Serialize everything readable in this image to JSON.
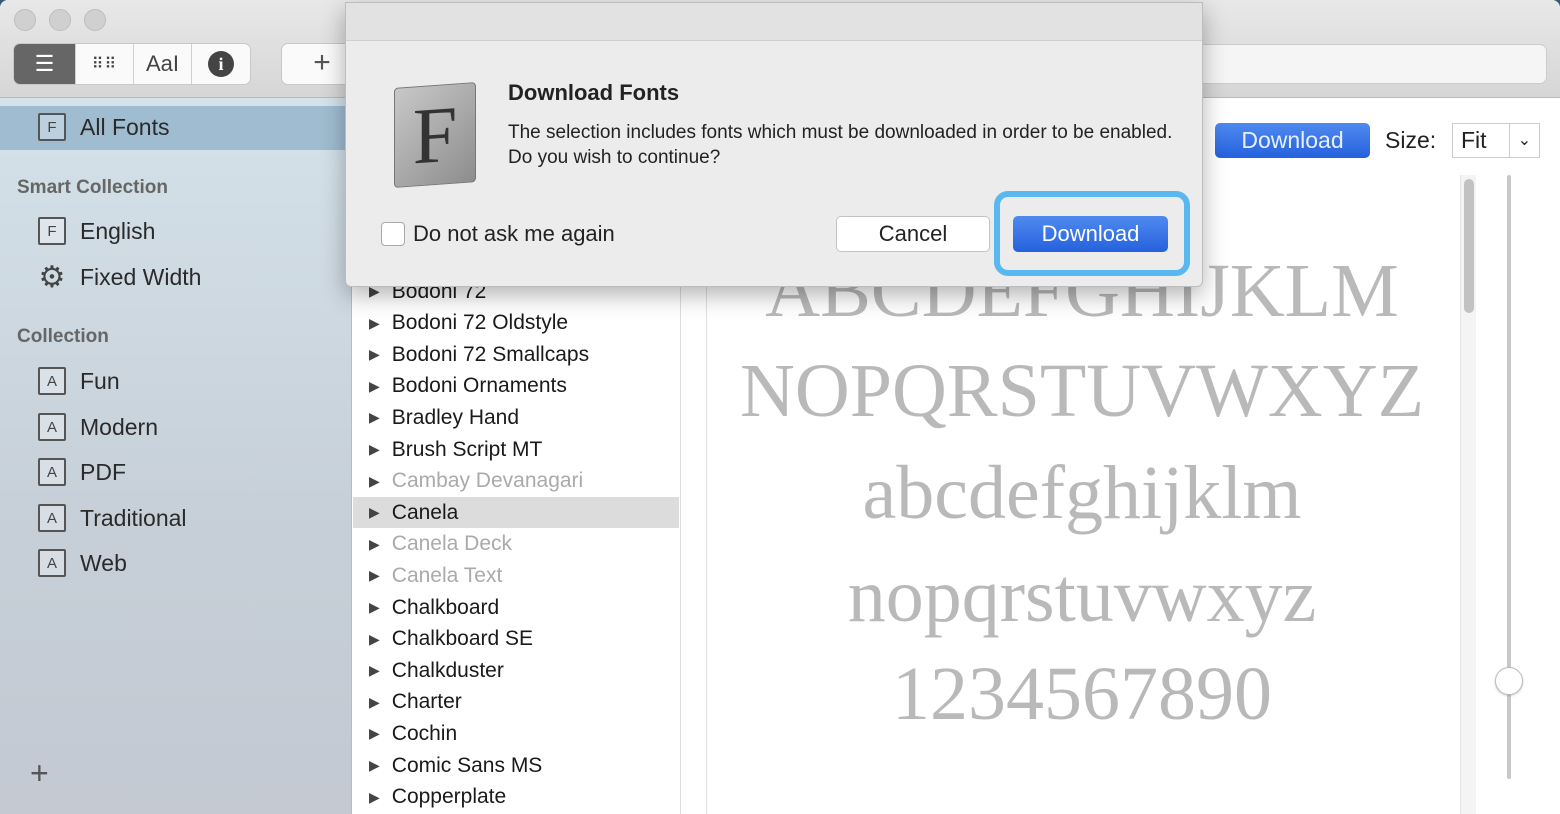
{
  "toolbar": {
    "views": [
      "list-view",
      "grid-view",
      "sample-view",
      "info-view"
    ],
    "sample_label": "AaI",
    "add_label": "+"
  },
  "sidebar": {
    "all_fonts": "All Fonts",
    "smart_header": "Smart Collection",
    "smart": [
      {
        "label": "English",
        "icon": "font-book-icon"
      },
      {
        "label": "Fixed Width",
        "icon": "gear-icon"
      }
    ],
    "collection_header": "Collection",
    "collections": [
      "Fun",
      "Modern",
      "PDF",
      "Traditional",
      "Web"
    ],
    "add_label": "+"
  },
  "font_list": [
    {
      "name": "Bodoni 72",
      "dim": false
    },
    {
      "name": "Bodoni 72 Oldstyle",
      "dim": false
    },
    {
      "name": "Bodoni 72 Smallcaps",
      "dim": false
    },
    {
      "name": "Bodoni Ornaments",
      "dim": false
    },
    {
      "name": "Bradley Hand",
      "dim": false
    },
    {
      "name": "Brush Script MT",
      "dim": false
    },
    {
      "name": "Cambay Devanagari",
      "dim": true
    },
    {
      "name": "Canela",
      "dim": false,
      "selected": true
    },
    {
      "name": "Canela Deck",
      "dim": true
    },
    {
      "name": "Canela Text",
      "dim": true
    },
    {
      "name": "Chalkboard",
      "dim": false
    },
    {
      "name": "Chalkboard SE",
      "dim": false
    },
    {
      "name": "Chalkduster",
      "dim": false
    },
    {
      "name": "Charter",
      "dim": false
    },
    {
      "name": "Cochin",
      "dim": false
    },
    {
      "name": "Comic Sans MS",
      "dim": false
    },
    {
      "name": "Copperplate",
      "dim": false
    }
  ],
  "preview": {
    "download_label": "Download",
    "size_label": "Size:",
    "size_value": "Fit",
    "lines": [
      "ABCDEFGHIJKLM",
      "NOPQRSTUVWXYZ",
      "abcdefghijklm",
      "nopqrstuvwxyz",
      "1234567890"
    ]
  },
  "dialog": {
    "title": "Download Fonts",
    "message": "The selection includes fonts which must be downloaded in order to be enabled. Do you wish to continue?",
    "checkbox_label": "Do not ask me again",
    "checked": false,
    "cancel": "Cancel",
    "confirm": "Download",
    "icon_letter": "F"
  },
  "colors": {
    "accent": "#2f6fe4",
    "focus_ring": "#5ab8f0",
    "sidebar_selection": "#9fbcd0"
  }
}
